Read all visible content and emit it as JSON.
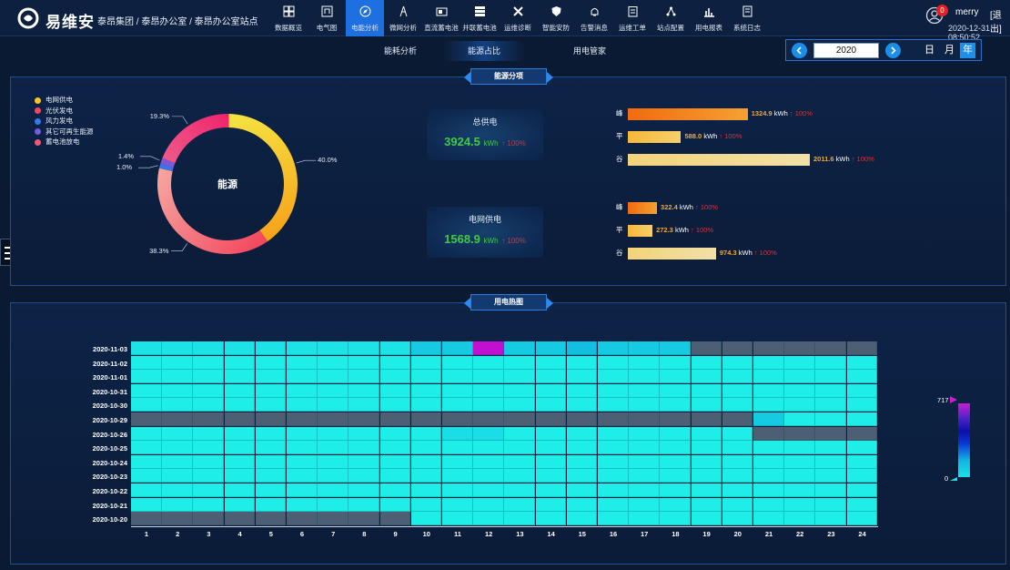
{
  "app": {
    "brand": "易维安",
    "breadcrumb": "泰昂集团 / 泰昂办公室 / 泰昂办公室站点"
  },
  "nav": [
    {
      "label": "数据概览",
      "icon": "grid-icon"
    },
    {
      "label": "电气图",
      "icon": "diagram-icon"
    },
    {
      "label": "电能分析",
      "icon": "compass-icon",
      "active": true
    },
    {
      "label": "微网分析",
      "icon": "tower-icon"
    },
    {
      "label": "直流蓄电池",
      "icon": "battery-icon"
    },
    {
      "label": "并联蓄电池",
      "icon": "stack-icon"
    },
    {
      "label": "运维诊断",
      "icon": "tools-icon"
    },
    {
      "label": "智能安防",
      "icon": "shield-icon"
    },
    {
      "label": "告警消息",
      "icon": "bell-icon"
    },
    {
      "label": "运维工单",
      "icon": "clipboard-icon"
    },
    {
      "label": "站点配置",
      "icon": "network-icon"
    },
    {
      "label": "用电报表",
      "icon": "chart-icon"
    },
    {
      "label": "系统日志",
      "icon": "log-icon"
    }
  ],
  "user": {
    "badge": "0",
    "name": "merry",
    "logout": "[退出]",
    "time": "2020-12-31 08:50:52"
  },
  "subtabs": [
    {
      "label": "能耗分析"
    },
    {
      "label": "能源占比",
      "active": true
    },
    {
      "label": "用电管家"
    }
  ],
  "yearpicker": {
    "value": "2020",
    "modes": [
      "日",
      "月",
      "年"
    ],
    "active": "年"
  },
  "panel1": {
    "title": "能源分项"
  },
  "panel2": {
    "title": "用电热图"
  },
  "pie": {
    "center": "能源",
    "legend": [
      {
        "name": "电网供电",
        "color": "#f6c623"
      },
      {
        "name": "光伏发电",
        "color": "#f2475f"
      },
      {
        "name": "风力发电",
        "color": "#3b79e8"
      },
      {
        "name": "其它可再生能源",
        "color": "#6f5ed8"
      },
      {
        "name": "蓄电池放电",
        "color": "#f2577a"
      }
    ],
    "slices": [
      {
        "name": "电网供电",
        "value": 40.0,
        "label": "40.0%",
        "colors": [
          "#f5e441",
          "#f7a21a"
        ]
      },
      {
        "name": "光伏发电",
        "value": 38.3,
        "label": "38.3%",
        "colors": [
          "#f3455c",
          "#f6a6a0"
        ]
      },
      {
        "name": "风力发电",
        "value": 1.0,
        "label": "1.0%",
        "colors": [
          "#3a74e6",
          "#3a74e6"
        ]
      },
      {
        "name": "其它可再生能源",
        "value": 1.4,
        "label": "1.4%",
        "colors": [
          "#7a58d6",
          "#7a58d6"
        ]
      },
      {
        "name": "蓄电池放电",
        "value": 19.3,
        "label": "19.3%",
        "colors": [
          "#ee5a8a",
          "#f0236a"
        ]
      }
    ]
  },
  "cards": [
    {
      "title": "总供电",
      "value": "3924.5",
      "unit": "kWh",
      "change": "↑ 100%"
    },
    {
      "title": "电网供电",
      "value": "1568.9",
      "unit": "kWh",
      "change": "↑ 100%"
    }
  ],
  "bars_total": [
    {
      "label": "峰",
      "value": 1324.9,
      "text": "1324.9",
      "unit": "kWh",
      "change": "↑ 100%"
    },
    {
      "label": "平",
      "value": 588.0,
      "text": "588.0",
      "unit": "kWh",
      "change": "↑ 100%"
    },
    {
      "label": "谷",
      "value": 2011.6,
      "text": "2011.6",
      "unit": "kWh",
      "change": "↑ 100%"
    }
  ],
  "bars_grid": [
    {
      "label": "峰",
      "value": 322.4,
      "text": "322.4",
      "unit": "kWh",
      "change": "↑ 100%"
    },
    {
      "label": "平",
      "value": 272.3,
      "text": "272.3",
      "unit": "kWh",
      "change": "↑ 100%"
    },
    {
      "label": "谷",
      "value": 974.3,
      "text": "974.3",
      "unit": "kWh",
      "change": "↑ 100%"
    }
  ],
  "chart_data": {
    "type": "heatmap",
    "title": "用电热图",
    "x": [
      "1",
      "2",
      "3",
      "4",
      "5",
      "6",
      "7",
      "8",
      "9",
      "10",
      "11",
      "12",
      "13",
      "14",
      "15",
      "16",
      "17",
      "18",
      "19",
      "20",
      "21",
      "22",
      "23",
      "24"
    ],
    "y": [
      "2020-11-03",
      "2020-11-02",
      "2020-11-01",
      "2020-10-31",
      "2020-10-30",
      "2020-10-29",
      "2020-10-26",
      "2020-10-25",
      "2020-10-24",
      "2020-10-23",
      "2020-10-22",
      "2020-10-21",
      "2020-10-20"
    ],
    "values": [
      [
        20,
        20,
        20,
        20,
        20,
        20,
        20,
        20,
        20,
        60,
        60,
        717,
        60,
        60,
        80,
        60,
        60,
        60,
        null,
        null,
        null,
        null,
        null,
        null
      ],
      [
        5,
        5,
        5,
        5,
        5,
        5,
        5,
        5,
        5,
        5,
        5,
        5,
        5,
        5,
        5,
        5,
        5,
        5,
        5,
        5,
        5,
        5,
        5,
        5
      ],
      [
        5,
        5,
        5,
        5,
        5,
        5,
        5,
        5,
        5,
        5,
        5,
        5,
        5,
        5,
        5,
        5,
        5,
        5,
        5,
        5,
        5,
        5,
        5,
        5
      ],
      [
        5,
        5,
        5,
        5,
        5,
        5,
        5,
        5,
        5,
        5,
        5,
        5,
        5,
        5,
        5,
        5,
        5,
        5,
        5,
        5,
        5,
        5,
        5,
        5
      ],
      [
        5,
        5,
        5,
        5,
        5,
        5,
        5,
        5,
        5,
        5,
        5,
        5,
        5,
        5,
        5,
        5,
        5,
        5,
        5,
        5,
        5,
        5,
        5,
        5
      ],
      [
        null,
        null,
        null,
        null,
        null,
        null,
        null,
        null,
        null,
        null,
        null,
        null,
        null,
        null,
        null,
        null,
        null,
        null,
        null,
        null,
        60,
        5,
        5,
        5
      ],
      [
        5,
        5,
        5,
        5,
        5,
        5,
        5,
        5,
        5,
        5,
        30,
        30,
        5,
        5,
        5,
        5,
        5,
        5,
        5,
        5,
        null,
        null,
        null,
        null
      ],
      [
        3,
        3,
        3,
        3,
        3,
        3,
        3,
        3,
        3,
        3,
        3,
        3,
        3,
        3,
        3,
        3,
        3,
        3,
        3,
        3,
        3,
        3,
        3,
        3
      ],
      [
        3,
        3,
        3,
        3,
        3,
        3,
        3,
        3,
        3,
        3,
        3,
        3,
        3,
        3,
        3,
        3,
        3,
        3,
        3,
        3,
        3,
        3,
        3,
        3
      ],
      [
        3,
        3,
        3,
        3,
        3,
        3,
        3,
        3,
        3,
        3,
        3,
        3,
        3,
        3,
        3,
        3,
        3,
        3,
        3,
        3,
        3,
        3,
        3,
        3
      ],
      [
        3,
        3,
        3,
        3,
        3,
        3,
        3,
        3,
        3,
        3,
        3,
        3,
        3,
        3,
        3,
        3,
        3,
        3,
        3,
        3,
        3,
        3,
        3,
        3
      ],
      [
        3,
        3,
        3,
        3,
        3,
        3,
        3,
        3,
        3,
        3,
        3,
        3,
        3,
        3,
        3,
        3,
        3,
        3,
        3,
        3,
        3,
        3,
        3,
        3
      ],
      [
        null,
        null,
        null,
        null,
        null,
        null,
        null,
        null,
        null,
        3,
        3,
        3,
        3,
        3,
        3,
        3,
        3,
        3,
        3,
        3,
        3,
        3,
        3,
        3
      ]
    ],
    "scale": {
      "min": 0,
      "max": 717,
      "min_label": "0",
      "max_label": "717"
    },
    "colors": {
      "empty": "#4d5f73",
      "low": "#1ee8e6",
      "high": "#c20fd0"
    }
  }
}
